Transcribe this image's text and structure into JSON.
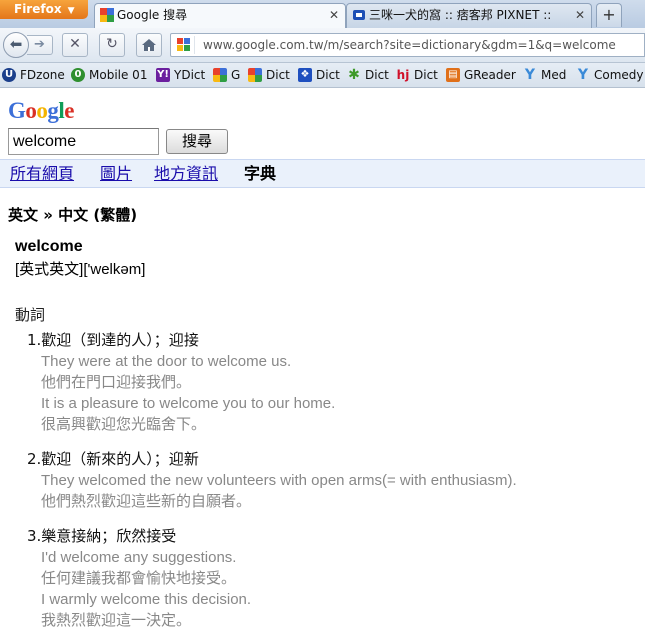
{
  "browser": {
    "app_menu_label": "Firefox",
    "tabs": [
      {
        "title": "Google 搜尋",
        "active": true
      },
      {
        "title": "三咪一犬的窩 :: 痞客邦 PIXNET ::",
        "active": false
      }
    ],
    "new_tab_label": "+",
    "url": "www.google.com.tw/m/search?site=dictionary&gdm=1&q=welcome"
  },
  "bookmarks": [
    {
      "label": "FDzone",
      "icon": "fdzone-icon",
      "color": "#1b3f8b"
    },
    {
      "label": "Mobile 01",
      "icon": "mobile01-icon",
      "color": "#2f8f2f"
    },
    {
      "label": "YDict",
      "icon": "yahoo-icon",
      "color": "#6b1f9e"
    },
    {
      "label": "G",
      "icon": "google-icon",
      "color": "#3c6fd8"
    },
    {
      "label": "Dict",
      "icon": "google-icon",
      "color": "#3c6fd8"
    },
    {
      "label": "Dict",
      "icon": "paw-icon",
      "color": "#1e4fbf"
    },
    {
      "label": "Dict",
      "icon": "leaf-icon",
      "color": "#3f9a2a"
    },
    {
      "label": "Dict",
      "icon": "hj-icon",
      "color": "#d0102a"
    },
    {
      "label": "GReader",
      "icon": "greader-icon",
      "color": "#e0701a"
    },
    {
      "label": "Med",
      "icon": "y-icon",
      "color": "#3a8ad8"
    },
    {
      "label": "Comedy",
      "icon": "y-icon",
      "color": "#3a8ad8"
    }
  ],
  "page": {
    "logo": "Google",
    "search_value": "welcome",
    "search_button": "搜尋",
    "nav_tabs": [
      {
        "label": "所有網頁",
        "current": false
      },
      {
        "label": "圖片",
        "current": false
      },
      {
        "label": "地方資訊",
        "current": false
      },
      {
        "label": "字典",
        "current": true
      }
    ],
    "direction": "英文 » 中文 (繁體)",
    "headword": "welcome",
    "pronunciation": "[英式英文]['welkəm]",
    "part_of_speech": "動詞",
    "senses": [
      {
        "definition": "1.歡迎（到達的人）；迎接",
        "examples": [
          {
            "en": "They were at the door to welcome us.",
            "zh": "他們在門口迎接我們。"
          },
          {
            "en": "It is a pleasure to welcome you to our home.",
            "zh": "很高興歡迎您光臨舍下。"
          }
        ]
      },
      {
        "definition": "2.歡迎（新來的人）；迎新",
        "examples": [
          {
            "en": "They welcomed the new volunteers with open arms(= with enthusiasm).",
            "zh": "他們熱烈歡迎這些新的自願者。"
          }
        ]
      },
      {
        "definition": "3.樂意接納；欣然接受",
        "examples": [
          {
            "en": "I'd welcome any suggestions.",
            "zh": "任何建議我都會愉快地接受。"
          },
          {
            "en": "I warmly welcome this decision.",
            "zh": "我熱烈歡迎這一決定。"
          }
        ]
      }
    ]
  }
}
